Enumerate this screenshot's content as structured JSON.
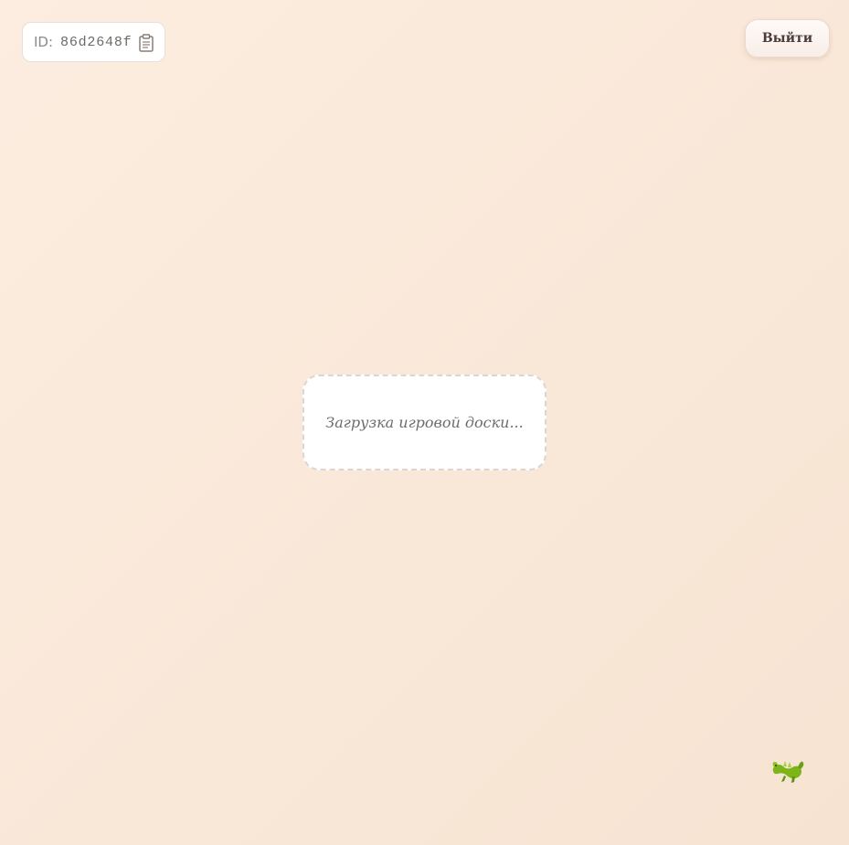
{
  "session": {
    "id_label": "ID:",
    "id_value": "86d2648f",
    "copy_icon": "clipboard-icon"
  },
  "header": {
    "logout_label": "Выйти"
  },
  "board": {
    "loading_text": "Загрузка игровой доски..."
  },
  "decor": {
    "mascot_icon": "dragon-icon"
  },
  "colors": {
    "background": "#fcede0",
    "card": "#ffffff",
    "text_muted": "#6f6b68",
    "button_text": "#4a3b34",
    "dragon_green": "#7cb518"
  }
}
